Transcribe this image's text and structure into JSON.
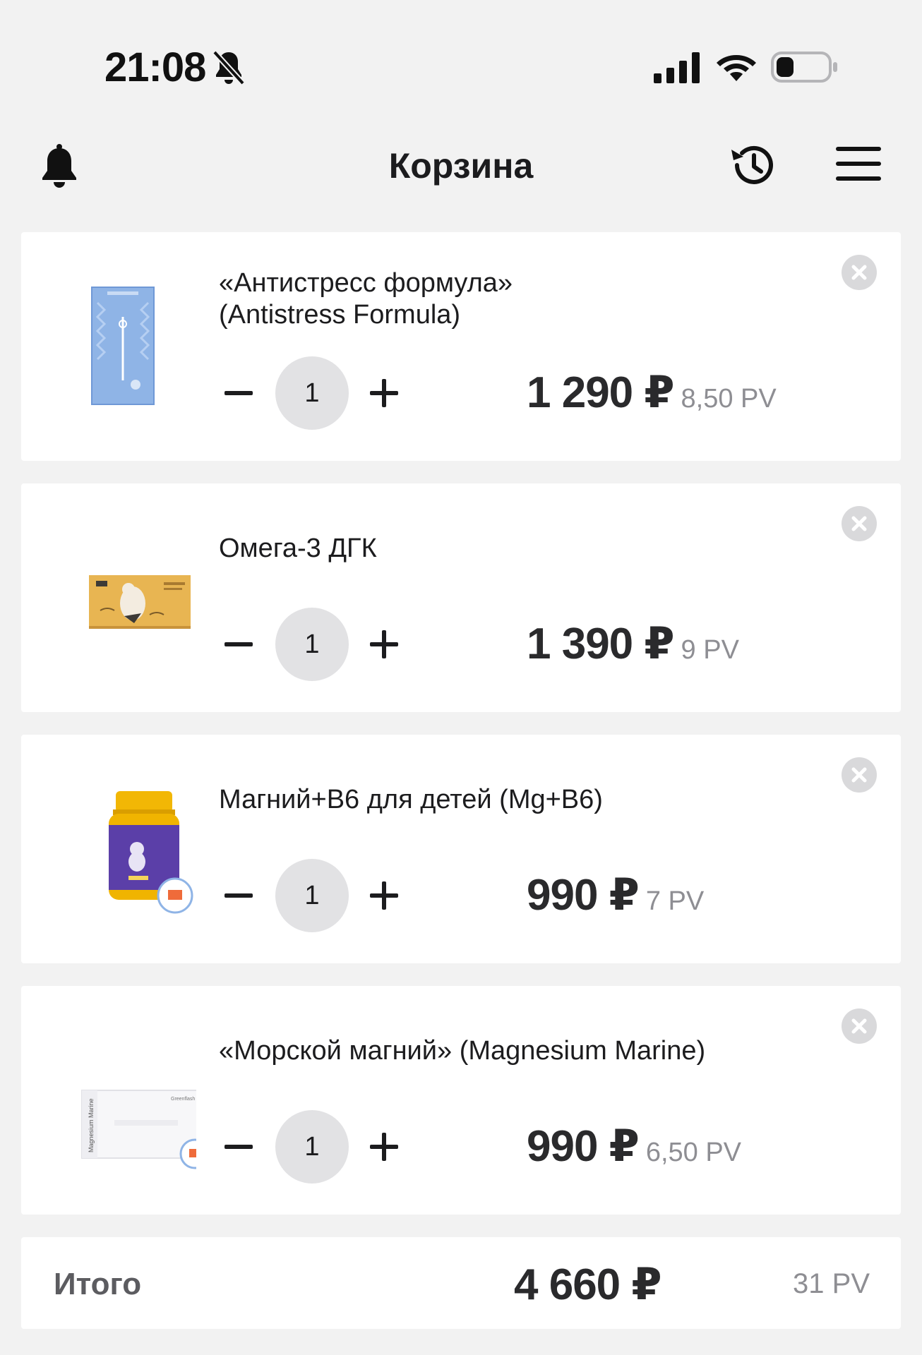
{
  "status_bar": {
    "time": "21:08",
    "icons": [
      "bell-off-icon",
      "signal-icon",
      "wifi-icon",
      "battery-icon"
    ]
  },
  "header": {
    "title": "Корзина",
    "icons": [
      "bell-icon",
      "history-icon",
      "menu-icon"
    ]
  },
  "cart": {
    "items": [
      {
        "name": "«Антистресс формула»\n(Antistress Formula)",
        "quantity": "1",
        "price": "1 290 ₽",
        "pv": "8,50 PV"
      },
      {
        "name": "Омега-3 ДГК",
        "quantity": "1",
        "price": "1 390 ₽",
        "pv": "9 PV"
      },
      {
        "name": "Магний+В6 для детей (Mg+B6)",
        "quantity": "1",
        "price": "990 ₽",
        "pv": "7 PV"
      },
      {
        "name": "«Морской магний» (Magnesium Marine)",
        "quantity": "1",
        "price": "990 ₽",
        "pv": "6,50 PV"
      }
    ],
    "product_image_labels": {
      "item4_box_side": "Magnesium Marine",
      "item4_brand": "Greenflash"
    }
  },
  "total": {
    "label": "Итого",
    "price": "4 660 ₽",
    "pv": "31 PV"
  },
  "colors": {
    "background": "#f2f2f2",
    "card": "#ffffff",
    "qty_circle": "#e2e2e4",
    "remove_circle": "#d9d9db",
    "pv_text": "#8e8e93"
  }
}
